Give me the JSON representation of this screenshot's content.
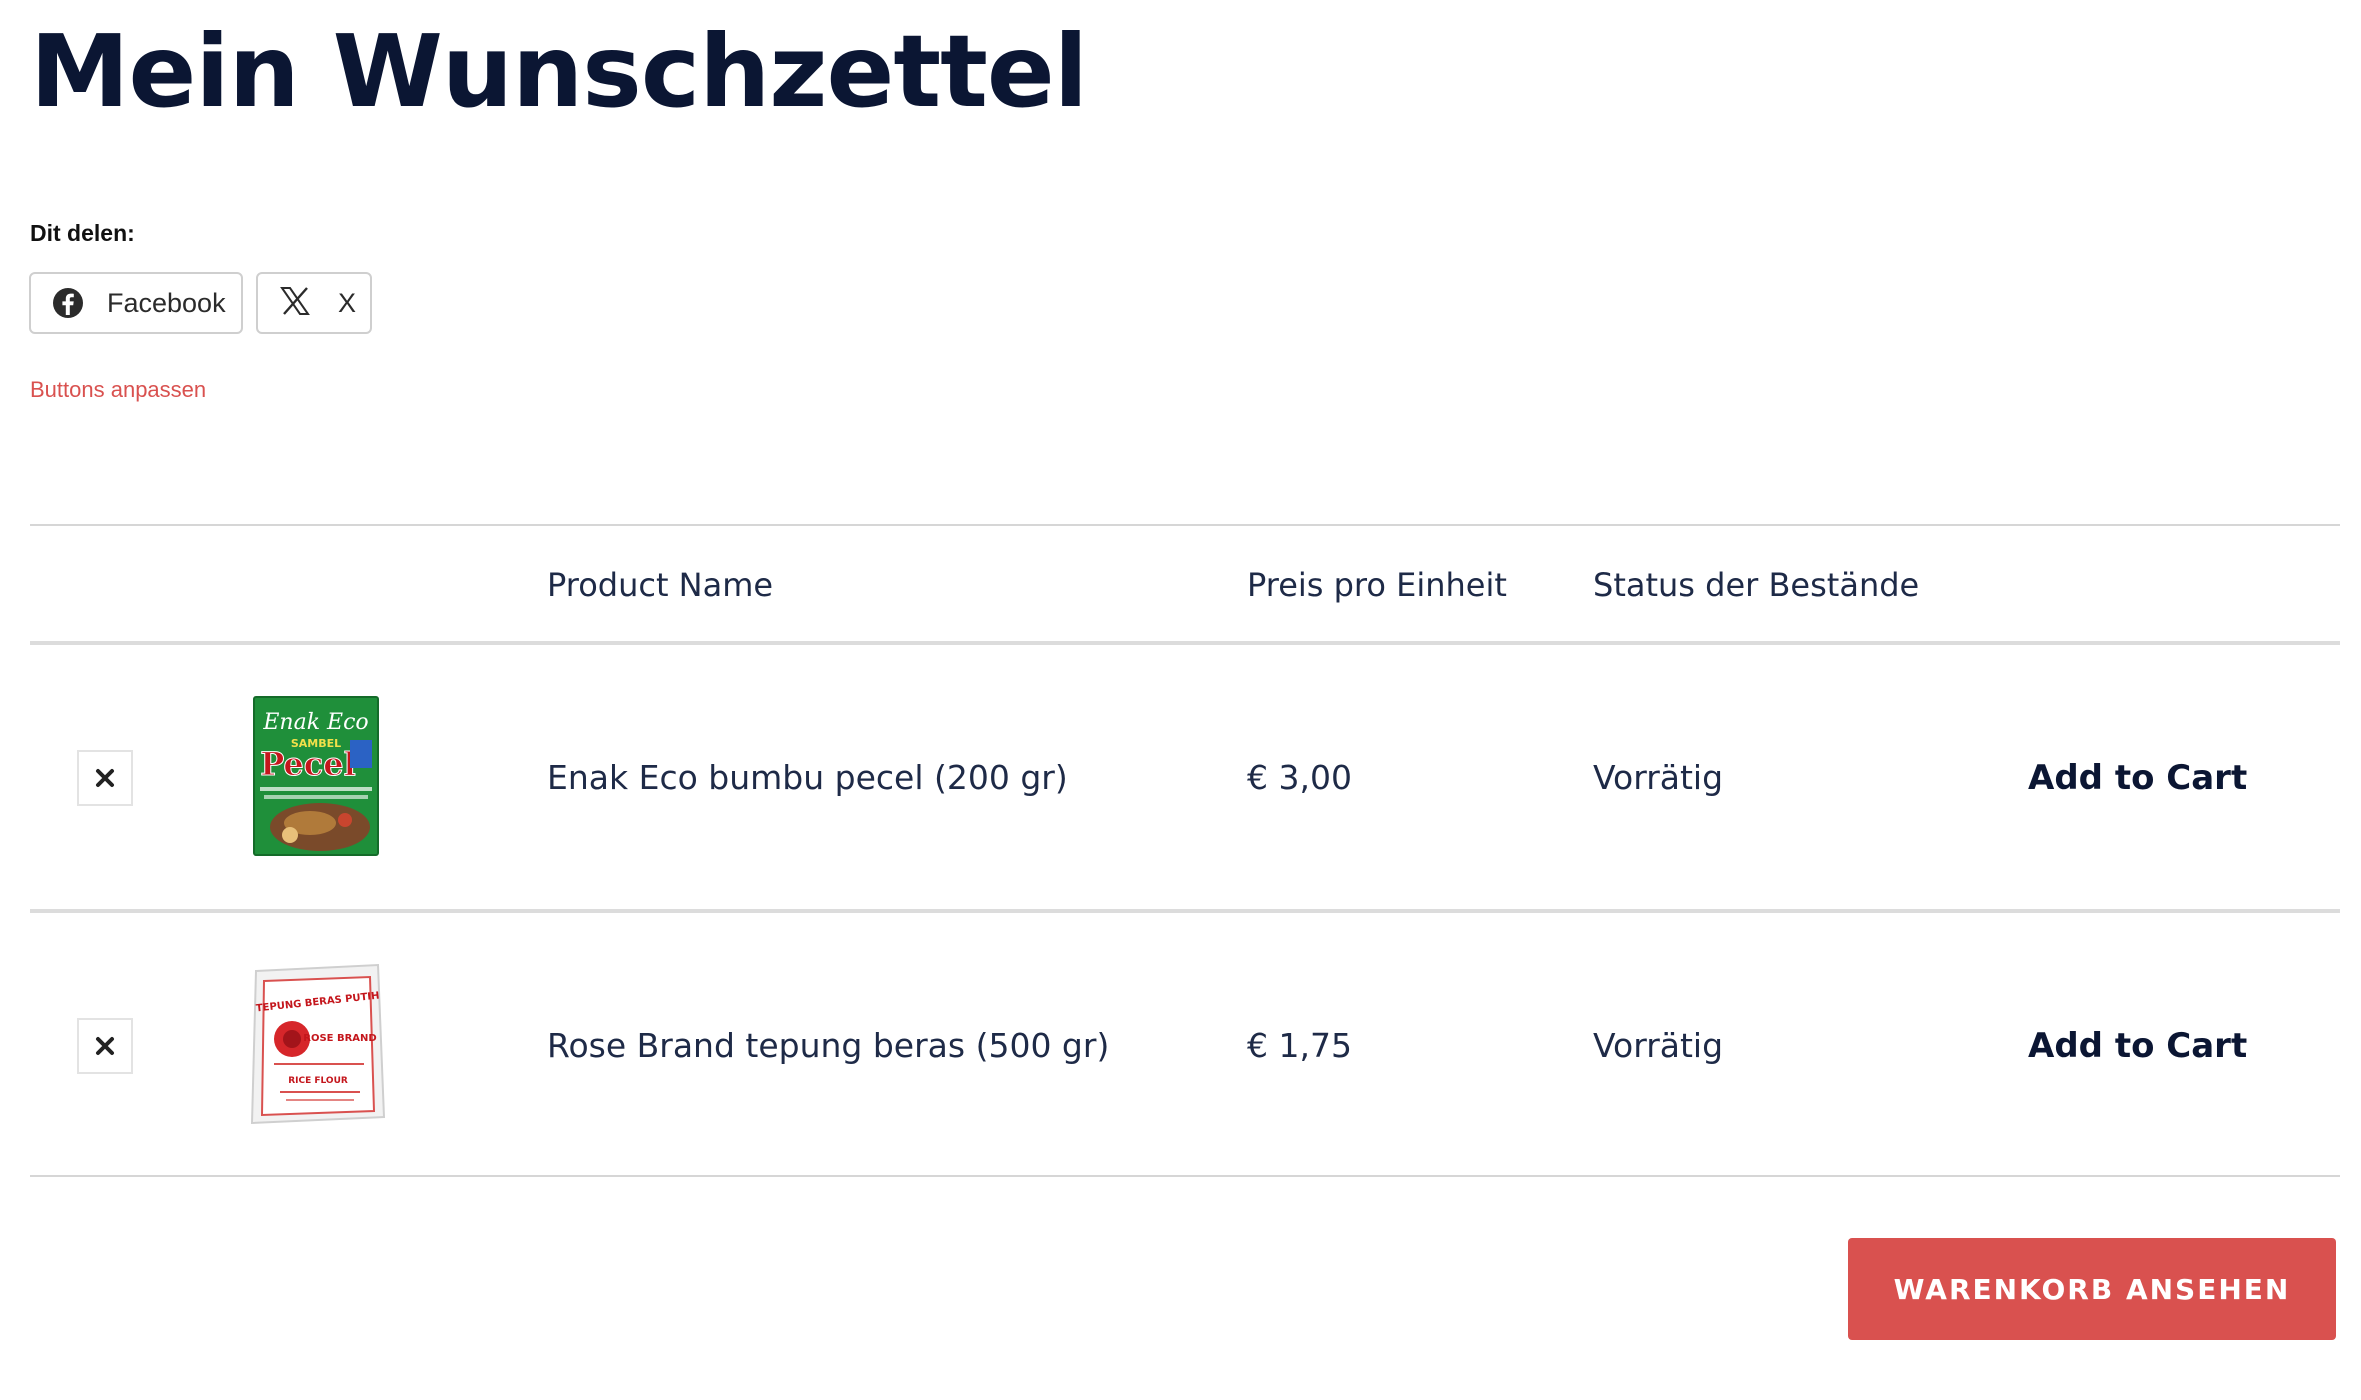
{
  "page": {
    "title": "Mein Wunschzettel"
  },
  "share": {
    "label": "Dit delen:",
    "buttons": [
      {
        "label": "Facebook",
        "icon": "facebook-icon"
      },
      {
        "label": "X",
        "icon": "x-logo-icon"
      }
    ],
    "customize_link": "Buttons anpassen"
  },
  "table": {
    "headers": {
      "product_name": "Product Name",
      "unit_price": "Preis pro Einheit",
      "stock_status": "Status der Bestände"
    },
    "rows": [
      {
        "name": "Enak Eco bumbu pecel (200 gr)",
        "price": "€ 3,00",
        "stock": "Vorrätig",
        "action": "Add to Cart",
        "thumb_text": {
          "brand": "Enak Eco",
          "product": "Pecel",
          "line": "SAMBEL"
        }
      },
      {
        "name": "Rose Brand tepung beras (500 gr)",
        "price": "€ 1,75",
        "stock": "Vorrätig",
        "action": "Add to Cart",
        "thumb_text": {
          "product": "TEPUNG BERAS PUTIH",
          "brand": "ROSE BRAND",
          "line": "RICE FLOUR"
        }
      }
    ]
  },
  "cart_button": {
    "label": "WARENKORB ANSEHEN"
  },
  "colors": {
    "accent": "#d9514f",
    "title": "#0b1633",
    "text": "#1e2a47"
  }
}
